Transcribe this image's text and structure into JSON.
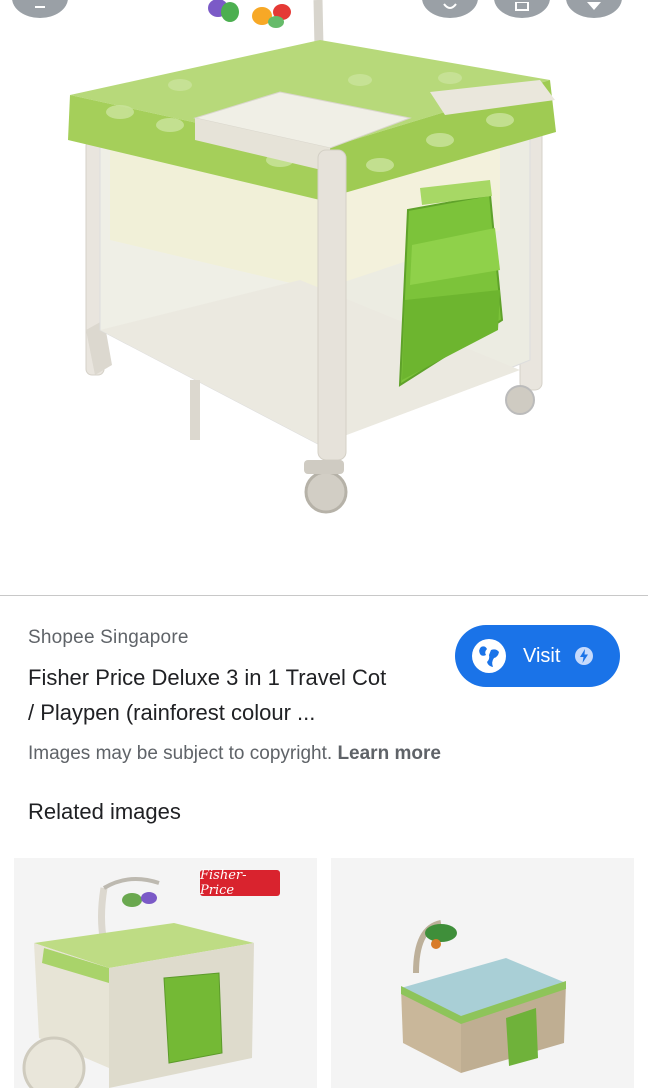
{
  "result": {
    "source": "Shopee Singapore",
    "title_line1": "Fisher Price Deluxe 3 in 1 Travel Cot",
    "title_line2": "/ Playpen (rainforest colour ...",
    "visit_label": "Visit"
  },
  "notice": {
    "text": "Images may be subject to copyright.",
    "link": "Learn more"
  },
  "related": {
    "heading": "Related images",
    "thumb1_brand": "Fisher-Price"
  },
  "icons": [
    "back-icon",
    "share-icon",
    "collection-icon",
    "star-icon",
    "globe-icon",
    "bolt-icon"
  ],
  "colors": {
    "accent": "#1a73e8",
    "leaf_green": "#9ccc47",
    "brand_red": "#d9232e"
  }
}
